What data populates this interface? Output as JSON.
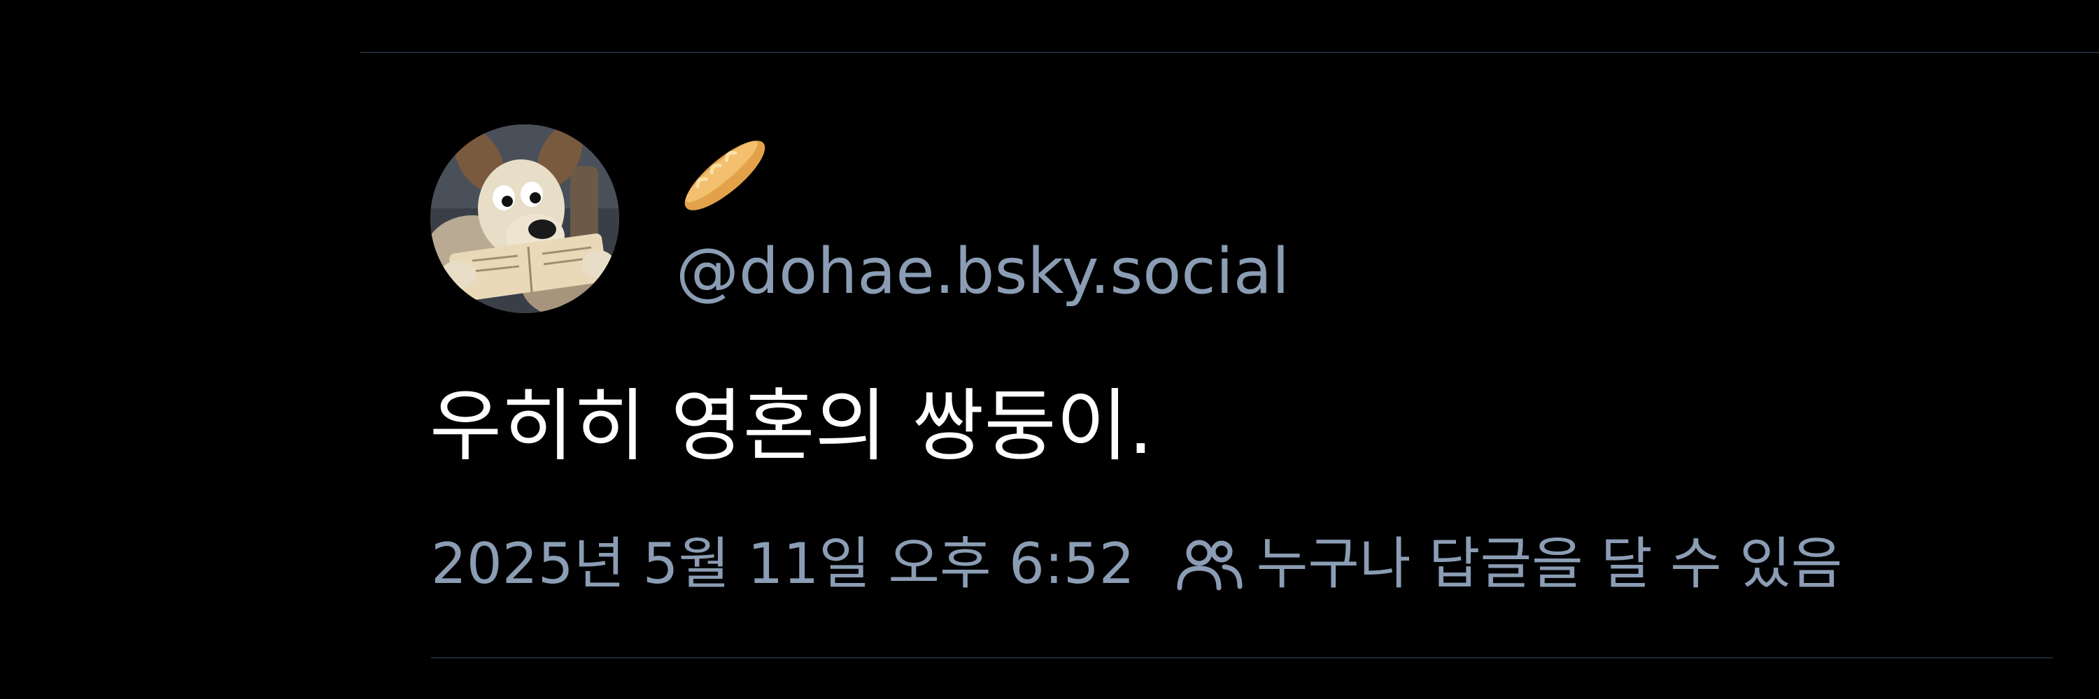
{
  "post": {
    "display_name": "🥖",
    "handle": "@dohae.bsky.social",
    "text": "우히히 영혼의 쌍둥이.",
    "timestamp": "2025년 5월 11일 오후 6:52",
    "reply_setting": "누구나 답글을 달 수 있음",
    "avatar_icon": "dog-reading-book-avatar",
    "display_name_icon": "baguette-icon",
    "reply_icon": "people-icon"
  },
  "colors": {
    "background": "#000000",
    "divider": "#1e2733",
    "secondary_text": "#8b9db4",
    "primary_text": "#ffffff"
  }
}
